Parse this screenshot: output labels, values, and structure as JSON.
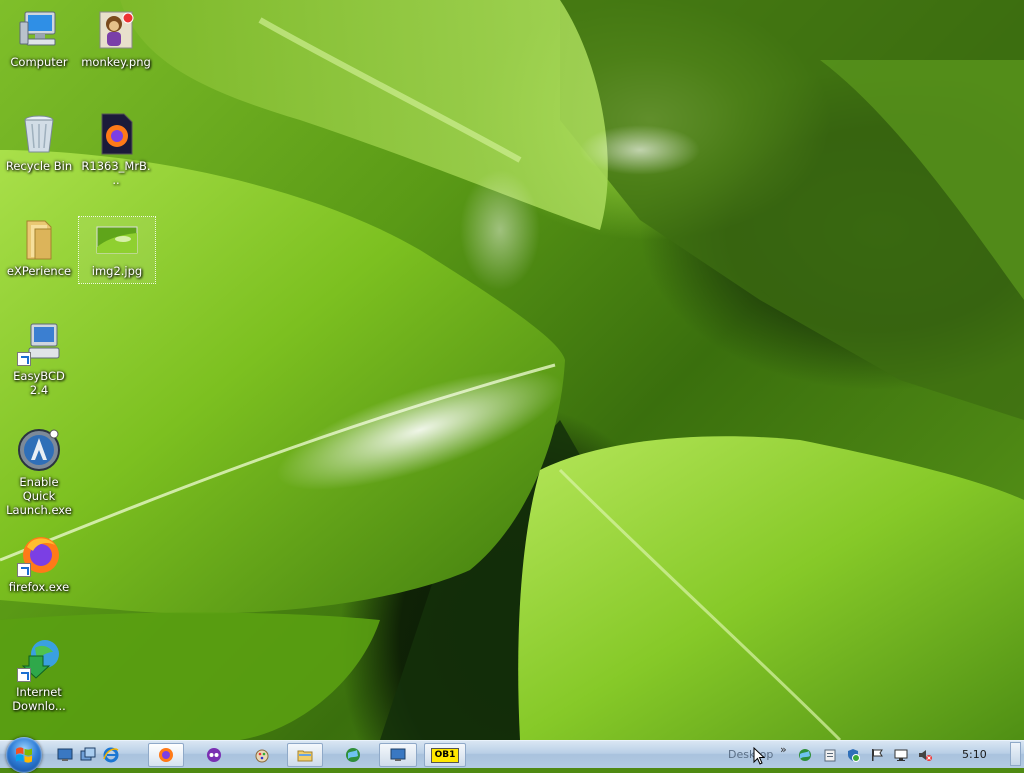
{
  "desktop": {
    "icons": [
      {
        "label": "Computer",
        "icon": "computer-icon"
      },
      {
        "label": "monkey.png",
        "icon": "monkey-image-icon"
      },
      {
        "label": "Recycle Bin",
        "icon": "recycle-bin-icon"
      },
      {
        "label": "R1363_MrB...",
        "icon": "firefox-document-icon"
      },
      {
        "label": "eXPerience",
        "icon": "folder-icon"
      },
      {
        "label": "img2.jpg",
        "icon": "image-file-icon",
        "selected": true
      },
      {
        "label": "EasyBCD 2.4",
        "icon": "easybcd-icon"
      },
      {
        "label": "Enable Quick Launch.exe",
        "icon": "quick-launch-exe-icon"
      },
      {
        "label": "firefox.exe",
        "icon": "firefox-icon"
      },
      {
        "label": "Internet Downlo...",
        "icon": "internet-download-manager-icon"
      }
    ]
  },
  "taskbar": {
    "start": {
      "icon": "windows-start-icon"
    },
    "quick_launch": [
      {
        "icon": "show-desktop-icon"
      },
      {
        "icon": "switch-windows-icon"
      },
      {
        "icon": "internet-explorer-icon"
      }
    ],
    "programs": [
      {
        "icon": "firefox-icon",
        "active": true
      },
      {
        "icon": "messenger-icon"
      },
      {
        "icon": "paint-icon"
      },
      {
        "icon": "file-explorer-icon"
      },
      {
        "icon": "globe-network-icon"
      },
      {
        "icon": "monitor-settings-icon"
      },
      {
        "label": "OB1",
        "icon": "ob1-icon"
      }
    ],
    "desktop_toolbar_label": "Desktop",
    "overflow_chevron": "»",
    "tray": [
      {
        "icon": "network-globe-tray-icon"
      },
      {
        "icon": "clipboard-tray-icon"
      },
      {
        "icon": "security-shield-tray-icon"
      },
      {
        "icon": "action-center-flag-icon"
      },
      {
        "icon": "network-monitor-tray-icon"
      },
      {
        "icon": "volume-muted-icon"
      }
    ],
    "clock": "5:10"
  },
  "colors": {
    "taskbar_top": "#d9e6f3",
    "taskbar_bottom": "#b4cbe3",
    "leaf_light": "#8fd030",
    "leaf_dark": "#2d5a10"
  }
}
